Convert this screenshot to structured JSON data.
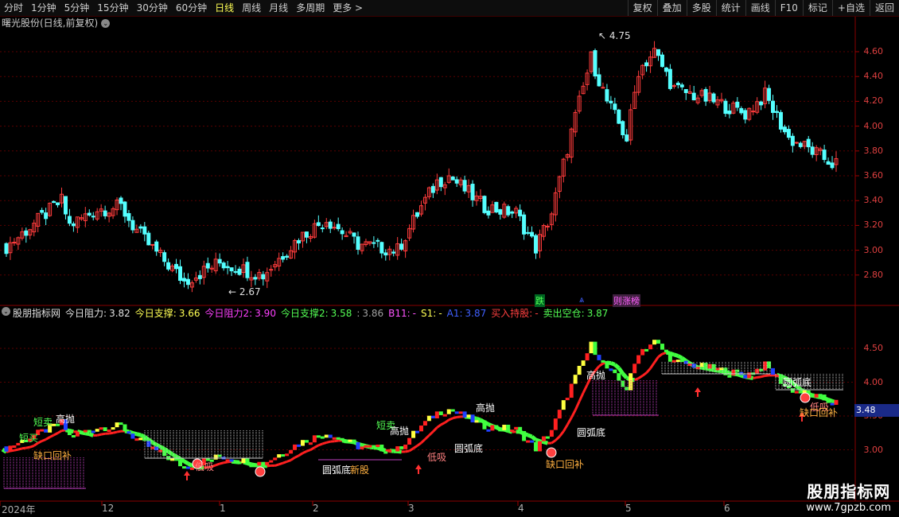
{
  "toolbar": {
    "left": [
      "分时",
      "1分钟",
      "5分钟",
      "15分钟",
      "30分钟",
      "60分钟",
      "日线",
      "周线",
      "月线",
      "多周期",
      "更多 >"
    ],
    "active_index": 6,
    "right": [
      "复权",
      "叠加",
      "多股",
      "统计",
      "画线",
      "F10",
      "标记",
      "+自选",
      "返回"
    ]
  },
  "main_title": "曙光股份(日线,前复权)",
  "main_title_icon": "chevron-down-icon",
  "main_yaxis": [
    "4.60",
    "4.40",
    "4.20",
    "4.00",
    "3.80",
    "3.60",
    "3.40",
    "3.20",
    "3.00",
    "2.80"
  ],
  "high_label": "4.75",
  "low_label": "2.67",
  "main_tags": {
    "drop": "跌",
    "board": "则涨榜"
  },
  "indicator": {
    "name": "股朋指标网",
    "items": [
      {
        "label": "今日阻力:",
        "value": "3.82",
        "color": "#e0e0e0"
      },
      {
        "label": "今日支撑:",
        "value": "3.66",
        "color": "#ffff54"
      },
      {
        "label": "今日阻力2:",
        "value": "3.90",
        "color": "#ff40ff"
      },
      {
        "label": "今日支撑2:",
        "value": "3.58",
        "color": "#54ff54"
      },
      {
        "label": ":",
        "value": "3.86",
        "color": "#a0a0a0"
      },
      {
        "label": "B11:",
        "value": "-",
        "color": "#ff54ff"
      },
      {
        "label": "S1:",
        "value": "-",
        "color": "#ffff54"
      },
      {
        "label": "A1:",
        "value": "3.87",
        "color": "#4060ff"
      },
      {
        "label": "买入持股:",
        "value": "-",
        "color": "#ff4040"
      },
      {
        "label": "卖出空仓:",
        "value": "3.87",
        "color": "#54ff54"
      }
    ]
  },
  "sub_yaxis": [
    "4.50",
    "4.00",
    "3.50",
    "3.00"
  ],
  "current_price": "3.48",
  "dates": [
    "2024年",
    "12",
    "1",
    "2",
    "3",
    "4",
    "5",
    "6"
  ],
  "annotations": [
    {
      "text": "短卖",
      "color": "#54ff54"
    },
    {
      "text": "高抛",
      "color": "#ffffff"
    },
    {
      "text": "短买",
      "color": "#54ff54"
    },
    {
      "text": "缺口回补",
      "color": "#ffb040"
    },
    {
      "text": "低吸",
      "color": "#ff8080"
    },
    {
      "text": "圆弧底",
      "color": "#ffffff"
    },
    {
      "text": "新股",
      "color": "#ffb040"
    },
    {
      "text": "短卖",
      "color": "#54ff54"
    },
    {
      "text": "高抛",
      "color": "#ffffff"
    },
    {
      "text": "低吸",
      "color": "#ff8080"
    },
    {
      "text": "高抛",
      "color": "#ffffff"
    },
    {
      "text": "圆弧底",
      "color": "#ffffff"
    },
    {
      "text": "缺口回补",
      "color": "#ffb040"
    },
    {
      "text": "圆弧底",
      "color": "#ffffff"
    },
    {
      "text": "高抛",
      "color": "#ffffff"
    },
    {
      "text": "圆弧底",
      "color": "#ffffff"
    },
    {
      "text": "低吸",
      "color": "#ff8080"
    },
    {
      "text": "缺口回补",
      "color": "#ffb040"
    }
  ],
  "watermark": {
    "title": "股朋指标网",
    "url": "www.7gpzb.com"
  }
}
